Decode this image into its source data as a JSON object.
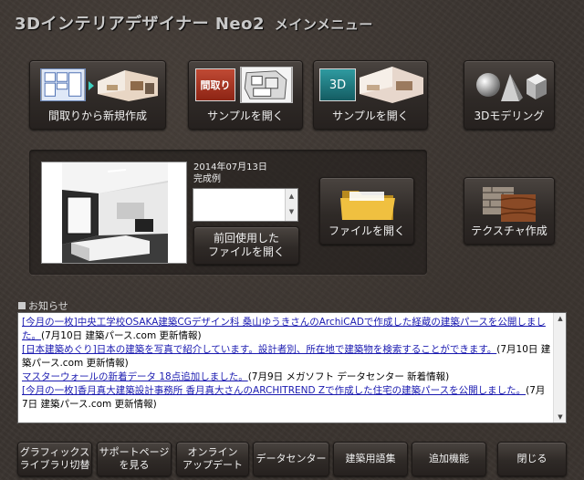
{
  "app": {
    "title": "3Dインテリアデザイナー Neo2",
    "subtitle": "メインメニュー"
  },
  "top_buttons": {
    "new_from_floorplan": "間取りから新規作成",
    "sample_floorplan_badge": "間取り",
    "open_sample_floorplan": "サンプルを開く",
    "sample_3d_badge": "3D",
    "open_sample_3d": "サンプルを開く",
    "modeling_3d": "3Dモデリング"
  },
  "recent": {
    "date": "2014年07月13日",
    "name": "完成例",
    "open_previous": "前回使用した\nファイルを開く"
  },
  "middle_buttons": {
    "open_file": "ファイルを開く",
    "create_texture": "テクスチャ作成"
  },
  "news": {
    "heading": "お知らせ",
    "items": [
      {
        "link": "[今月の一枚]中央工学校OSAKA建築CGデザイン科 桑山ゆうきさんのArchiCADで作成した経蔵の建築パースを公開しました。",
        "meta": "(7月10日 建築パース.com 更新情報)"
      },
      {
        "link": "[日本建築めぐり]日本の建築を写真で紹介しています。設計者別、所在地で建築物を検索することができます。",
        "meta": "(7月10日 建築パース.com 更新情報)"
      },
      {
        "link": "マスターウォールの新着データ 18点追加しました。",
        "meta": "(7月9日 メガソフト データセンター 新着情報)"
      },
      {
        "link": "[今月の一枚]香月真大建築設計事務所 香月真大さんのARCHITREND Zで作成した住宅の建築パースを公開しました。",
        "meta": "(7月7日 建築パース.com 更新情報)"
      }
    ]
  },
  "bottom_bar": {
    "graphics_library": "グラフィックス\nライブラリ切替",
    "support_page": "サポートページ\nを見る",
    "online_update": "オンライン\nアップデート",
    "data_center": "データセンター",
    "glossary": "建築用語集",
    "add_features": "追加機能",
    "close": "閉じる"
  },
  "colors": {
    "background": "#3b3531",
    "link": "#1a1ab0",
    "badge_floorplan": "#a0301e",
    "badge_3d": "#1f7a80",
    "folder": "#e0b030"
  }
}
